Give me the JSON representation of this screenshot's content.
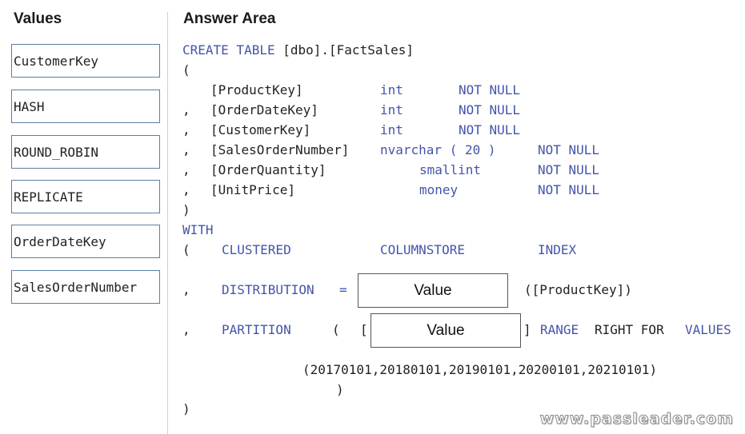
{
  "values_panel": {
    "title": "Values",
    "items": [
      "CustomerKey",
      "HASH",
      "ROUND_ROBIN",
      "REPLICATE",
      "OrderDateKey",
      "SalesOrderNumber"
    ]
  },
  "answer_area": {
    "title": "Answer Area",
    "line_create": "CREATE TABLE",
    "table_name": "[dbo].[FactSales]",
    "open_paren": "(",
    "columns": [
      {
        "prefix": "",
        "name": "[ProductKey]",
        "type": "int",
        "null": "NOT NULL"
      },
      {
        "prefix": ",",
        "name": "[OrderDateKey]",
        "type": "int",
        "null": "NOT NULL"
      },
      {
        "prefix": ",",
        "name": "[CustomerKey]",
        "type": "int",
        "null": "NOT NULL"
      },
      {
        "prefix": ",",
        "name": "[SalesOrderNumber]",
        "type": "nvarchar ( 20 )",
        "null": "NOT NULL"
      },
      {
        "prefix": ",",
        "name": "[OrderQuantity]",
        "type": "smallint",
        "null": "NOT NULL"
      },
      {
        "prefix": ",",
        "name": "[UnitPrice]",
        "type": "money",
        "null": "NOT NULL"
      }
    ],
    "close_paren": ")",
    "with_kw": "WITH",
    "index_open": "(",
    "clustered": "CLUSTERED",
    "columnstore": "COLUMNSTORE",
    "index_kw": "INDEX",
    "comma": ",",
    "distribution_kw": "DISTRIBUTION",
    "equals": "=",
    "distribution_value": "Value",
    "distribution_tail": "([ProductKey])",
    "partition_kw": "PARTITION",
    "partition_open": "(",
    "bracket_open": "[",
    "partition_value": "Value",
    "bracket_close": "]",
    "range_kw": "RANGE",
    "right_for": "RIGHT FOR",
    "values_kw": "VALUES",
    "boundaries": "(20170101,20180101,20190101,20200101,20210101)",
    "partition_close": ")",
    "final_close": ")"
  },
  "watermark": "www.passleader.com"
}
